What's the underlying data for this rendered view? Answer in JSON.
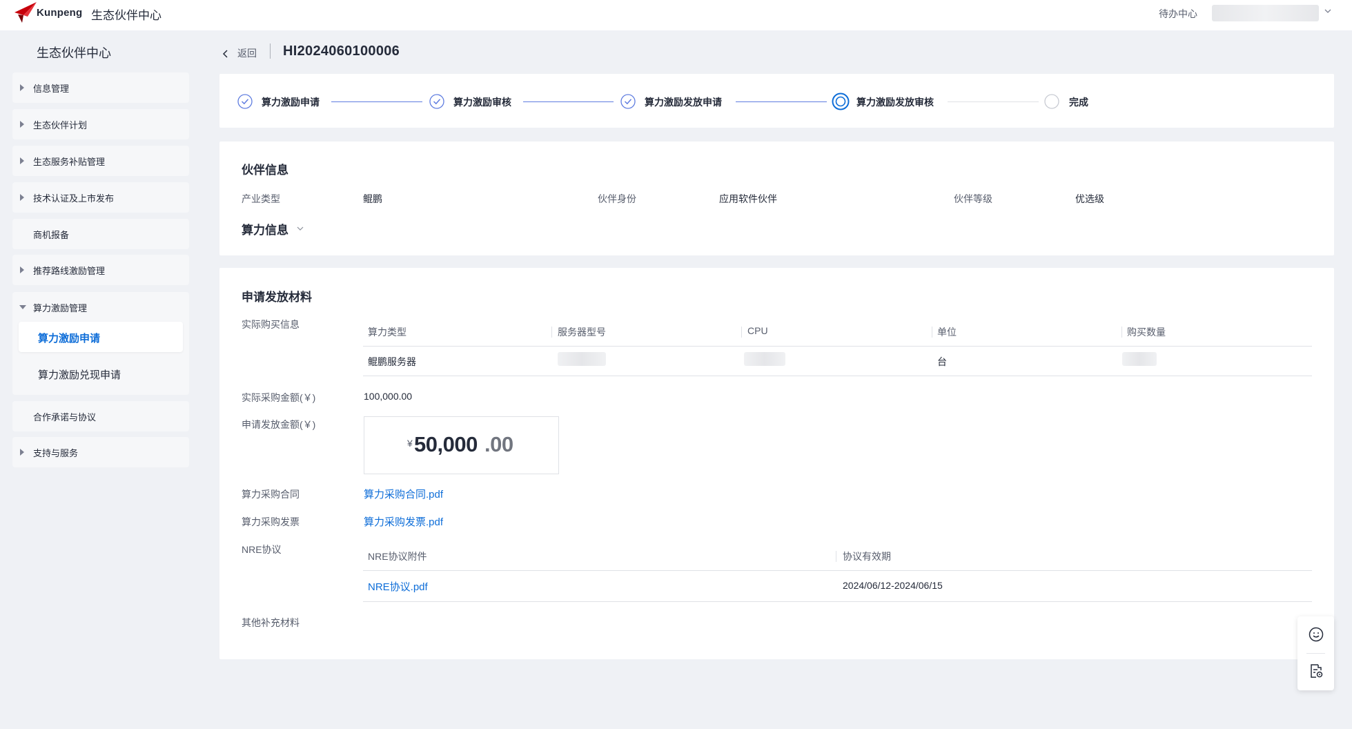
{
  "header": {
    "brand": "Kunpeng",
    "app_title": "生态伙伴中心",
    "todo_label": "待办中心"
  },
  "sidebar": {
    "title": "生态伙伴中心",
    "items": [
      {
        "label": "信息管理",
        "expandable": true
      },
      {
        "label": "生态伙伴计划",
        "expandable": true
      },
      {
        "label": "生态服务补贴管理",
        "expandable": true
      },
      {
        "label": "技术认证及上市发布",
        "expandable": true
      },
      {
        "label": "商机报备",
        "expandable": false
      },
      {
        "label": "推荐路线激励管理",
        "expandable": true
      },
      {
        "label": "合作承诺与协议",
        "expandable": false
      },
      {
        "label": "支持与服务",
        "expandable": true
      }
    ],
    "expanded_group": {
      "label": "算力激励管理",
      "children": [
        "算力激励申请",
        "算力激励兑现申请"
      ],
      "active_child": "算力激励申请"
    }
  },
  "page": {
    "back_label": "返回",
    "title": "HI2024060100006"
  },
  "steps": [
    {
      "label": "算力激励申请",
      "status": "done"
    },
    {
      "label": "算力激励审核",
      "status": "done"
    },
    {
      "label": "算力激励发放申请",
      "status": "done"
    },
    {
      "label": "算力激励发放审核",
      "status": "current"
    },
    {
      "label": "完成",
      "status": "pending"
    }
  ],
  "partner": {
    "section_title": "伙伴信息",
    "fields": [
      {
        "key": "产业类型",
        "value": "鲲鹏"
      },
      {
        "key": "伙伴身份",
        "value": "应用软件伙伴"
      },
      {
        "key": "伙伴等级",
        "value": "优选级"
      }
    ],
    "compute_title": "算力信息"
  },
  "material": {
    "section_title": "申请发放材料",
    "purchase_info_label": "实际购买信息",
    "purchase_table": {
      "headers": [
        "算力类型",
        "服务器型号",
        "CPU",
        "单位",
        "购买数量"
      ],
      "rows": [
        {
          "type": "鲲鹏服务器",
          "unit": "台"
        }
      ]
    },
    "actual_amount_label": "实际采购金额(￥)",
    "actual_amount": "100,000.00",
    "apply_amount_label": "申请发放金额(￥)",
    "apply_amount_symbol": "¥",
    "apply_amount_int": "50,000",
    "apply_amount_dec": ".00",
    "contract_label": "算力采购合同",
    "contract_file": "算力采购合同.pdf",
    "invoice_label": "算力采购发票",
    "invoice_file": "算力采购发票.pdf",
    "nre_label": "NRE协议",
    "nre_table": {
      "headers": [
        "NRE协议附件",
        "协议有效期"
      ],
      "rows": [
        {
          "file": "NRE协议.pdf",
          "period": "2024/06/12-2024/06/15"
        }
      ]
    },
    "other_label": "其他补充材料"
  },
  "colors": {
    "accent": "#0d6dd8",
    "step_done": "#5e7ce0",
    "background": "#eff1f5"
  }
}
